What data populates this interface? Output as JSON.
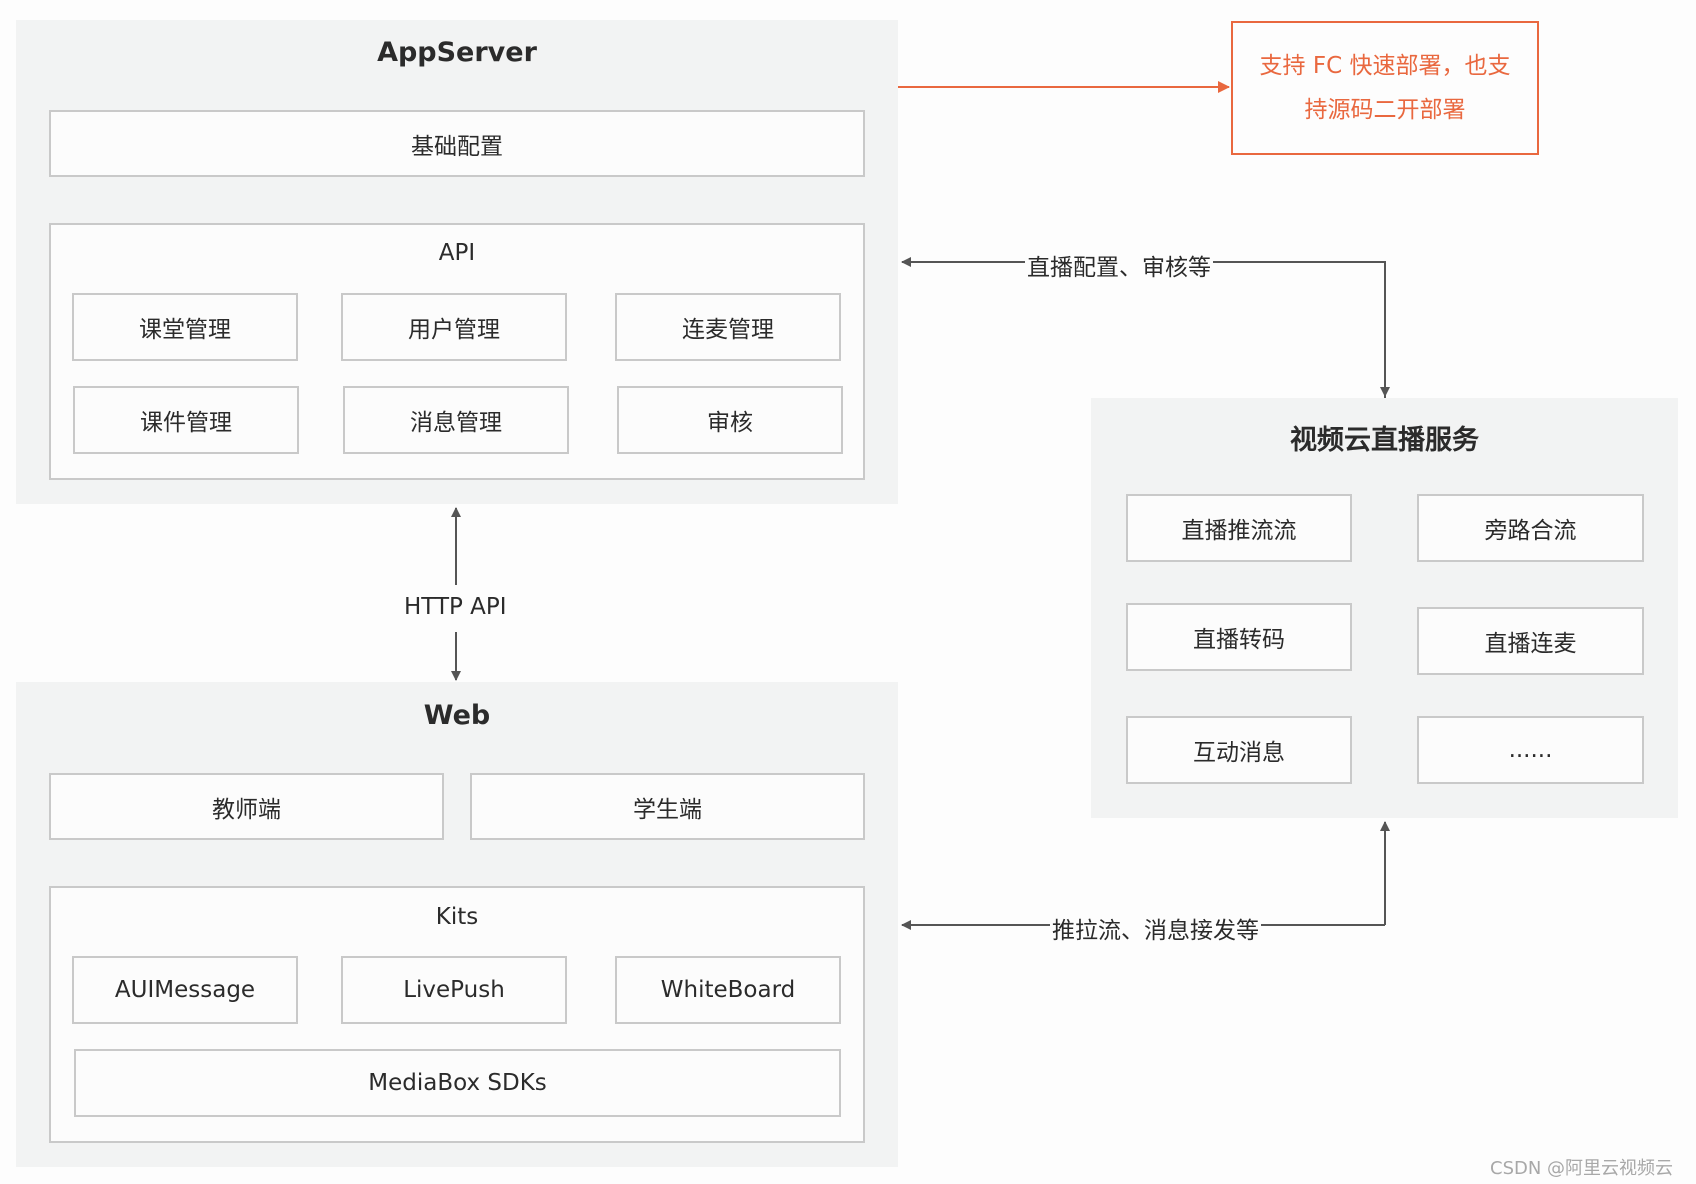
{
  "appserver": {
    "title": "AppServer",
    "base_config": "基础配置",
    "api": {
      "title": "API",
      "items": [
        "课堂管理",
        "用户管理",
        "连麦管理",
        "课件管理",
        "消息管理",
        "审核"
      ]
    }
  },
  "note": {
    "text": "支持 FC 快速部署，也支持源码二开部署",
    "color": "#e9683f"
  },
  "http_link": {
    "label": "HTTP API"
  },
  "web": {
    "title": "Web",
    "clients": [
      "教师端",
      "学生端"
    ],
    "kits": {
      "title": "Kits",
      "items": [
        "AUIMessage",
        "LivePush",
        "WhiteBoard"
      ],
      "sdk": "MediaBox SDKs"
    }
  },
  "live_service": {
    "title": "视频云直播服务",
    "items": [
      "直播推流流",
      "旁路合流",
      "直播转码",
      "直播连麦",
      "互动消息",
      "......"
    ]
  },
  "edges": {
    "config_audit": "直播配置、审核等",
    "stream_msg": "推拉流、消息接发等"
  },
  "watermark": "CSDN @阿里云视频云"
}
